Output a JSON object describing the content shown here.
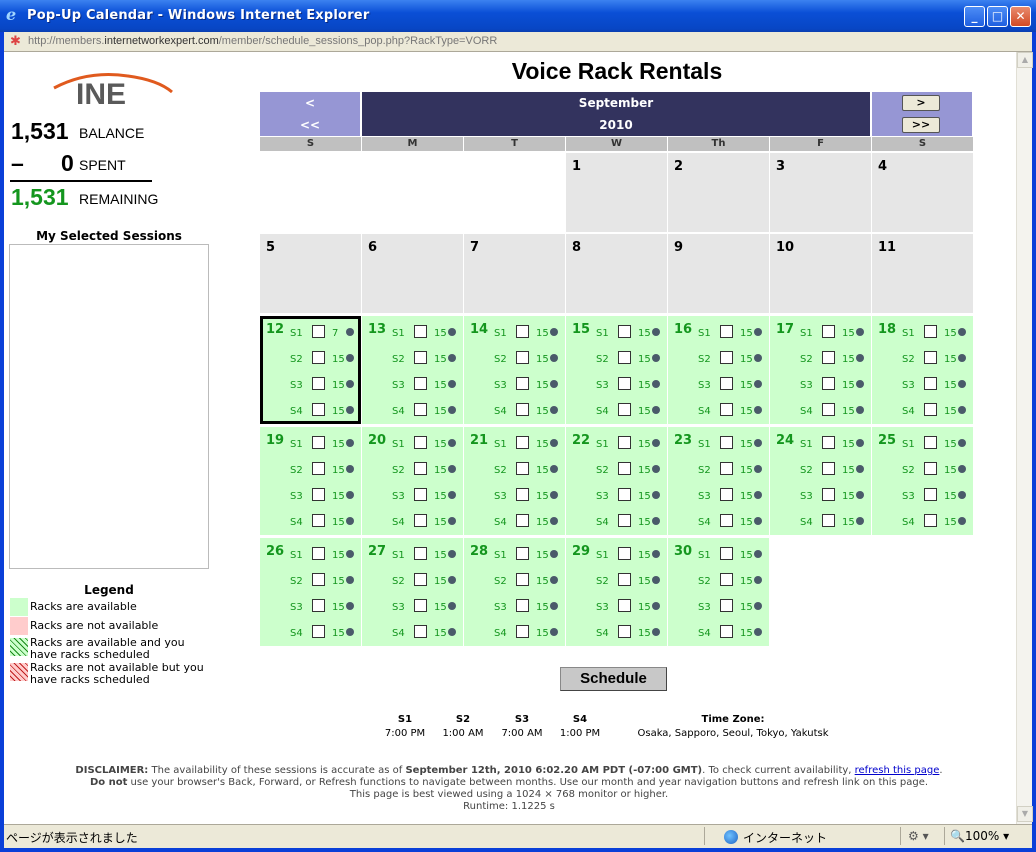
{
  "window": {
    "title": "Pop-Up Calendar - Windows Internet Explorer",
    "url_prefix": "http://members.",
    "url_domain": "internetworkexpert.com",
    "url_path": "/member/schedule_sessions_pop.php?RackType=VORR"
  },
  "status_bar": {
    "text": "ページが表示されました",
    "zone": "インターネット",
    "zoom": "100%"
  },
  "logo": {
    "text": "INE",
    "color": "#e05a1e"
  },
  "balance": {
    "balance_value": "1,531",
    "balance_label": "BALANCE",
    "spent_sign": "–",
    "spent_value": "0",
    "spent_label": "SPENT",
    "remaining_value": "1,531",
    "remaining_label": "REMAINING"
  },
  "selected_sessions_title": "My Selected Sessions",
  "legend": {
    "title": "Legend",
    "items": [
      {
        "label": "Racks are available",
        "color": "#ccffcc"
      },
      {
        "label": "Racks are not available",
        "color": "#ffcccc"
      },
      {
        "label": "Racks are available and you have racks scheduled",
        "color": "#ccffcc"
      },
      {
        "label": "Racks are not available but you have racks scheduled",
        "color": "#ffcccc"
      }
    ]
  },
  "calendar": {
    "title": "Voice Rack Rentals",
    "month": "September",
    "year": "2010",
    "prev_month": "<",
    "next_month": ">",
    "prev_year": "<<",
    "next_year": ">>",
    "weekdays": [
      "S",
      "M",
      "T",
      "W",
      "Th",
      "F",
      "S"
    ],
    "days": [
      {
        "day": "1",
        "type": "gray"
      },
      {
        "day": "2",
        "type": "gray"
      },
      {
        "day": "3",
        "type": "gray"
      },
      {
        "day": "4",
        "type": "gray"
      },
      {
        "day": "5",
        "type": "gray"
      },
      {
        "day": "6",
        "type": "gray"
      },
      {
        "day": "7",
        "type": "gray"
      },
      {
        "day": "8",
        "type": "gray"
      },
      {
        "day": "9",
        "type": "gray"
      },
      {
        "day": "10",
        "type": "gray"
      },
      {
        "day": "11",
        "type": "gray"
      },
      {
        "day": "12",
        "type": "green",
        "selected": true,
        "counts": [
          "7",
          "15",
          "15",
          "15"
        ]
      },
      {
        "day": "13",
        "type": "green",
        "counts": [
          "15",
          "15",
          "15",
          "15"
        ]
      },
      {
        "day": "14",
        "type": "green",
        "counts": [
          "15",
          "15",
          "15",
          "15"
        ]
      },
      {
        "day": "15",
        "type": "green",
        "counts": [
          "15",
          "15",
          "15",
          "15"
        ]
      },
      {
        "day": "16",
        "type": "green",
        "counts": [
          "15",
          "15",
          "15",
          "15"
        ]
      },
      {
        "day": "17",
        "type": "green",
        "counts": [
          "15",
          "15",
          "15",
          "15"
        ]
      },
      {
        "day": "18",
        "type": "green",
        "counts": [
          "15",
          "15",
          "15",
          "15"
        ]
      },
      {
        "day": "19",
        "type": "green",
        "counts": [
          "15",
          "15",
          "15",
          "15"
        ]
      },
      {
        "day": "20",
        "type": "green",
        "counts": [
          "15",
          "15",
          "15",
          "15"
        ]
      },
      {
        "day": "21",
        "type": "green",
        "counts": [
          "15",
          "15",
          "15",
          "15"
        ]
      },
      {
        "day": "22",
        "type": "green",
        "counts": [
          "15",
          "15",
          "15",
          "15"
        ]
      },
      {
        "day": "23",
        "type": "green",
        "counts": [
          "15",
          "15",
          "15",
          "15"
        ]
      },
      {
        "day": "24",
        "type": "green",
        "counts": [
          "15",
          "15",
          "15",
          "15"
        ]
      },
      {
        "day": "25",
        "type": "green",
        "counts": [
          "15",
          "15",
          "15",
          "15"
        ]
      },
      {
        "day": "26",
        "type": "green",
        "counts": [
          "15",
          "15",
          "15",
          "15"
        ]
      },
      {
        "day": "27",
        "type": "green",
        "counts": [
          "15",
          "15",
          "15",
          "15"
        ]
      },
      {
        "day": "28",
        "type": "green",
        "counts": [
          "15",
          "15",
          "15",
          "15"
        ]
      },
      {
        "day": "29",
        "type": "green",
        "counts": [
          "15",
          "15",
          "15",
          "15"
        ]
      },
      {
        "day": "30",
        "type": "green",
        "counts": [
          "15",
          "15",
          "15",
          "15"
        ]
      }
    ],
    "session_labels": [
      "S1",
      "S2",
      "S3",
      "S4"
    ]
  },
  "schedule_button": "Schedule",
  "timezone": {
    "headers": [
      "S1",
      "S2",
      "S3",
      "S4"
    ],
    "times": [
      "7:00 PM",
      "1:00 AM",
      "7:00 AM",
      "1:00 PM"
    ],
    "tz_header": "Time Zone:",
    "tz_value": "Osaka, Sapporo, Seoul, Tokyo, Yakutsk"
  },
  "disclaimer": {
    "label": "DISCLAIMER:",
    "text1": " The availability of these sessions is accurate as of ",
    "date": "September 12th, 2010 6:02.20 AM PDT (-07:00 GMT)",
    "text2": ". To check current availability, ",
    "link": "refresh this page",
    "text3": ".",
    "donot": "Do not",
    "line2": " use your browser's Back, Forward, or Refresh functions to navigate between months. Use our month and year navigation buttons and refresh link on this page.",
    "line3": "This page is best viewed using a 1024 × 768 monitor or higher.",
    "runtime": "Runtime: 1.1225 s"
  }
}
